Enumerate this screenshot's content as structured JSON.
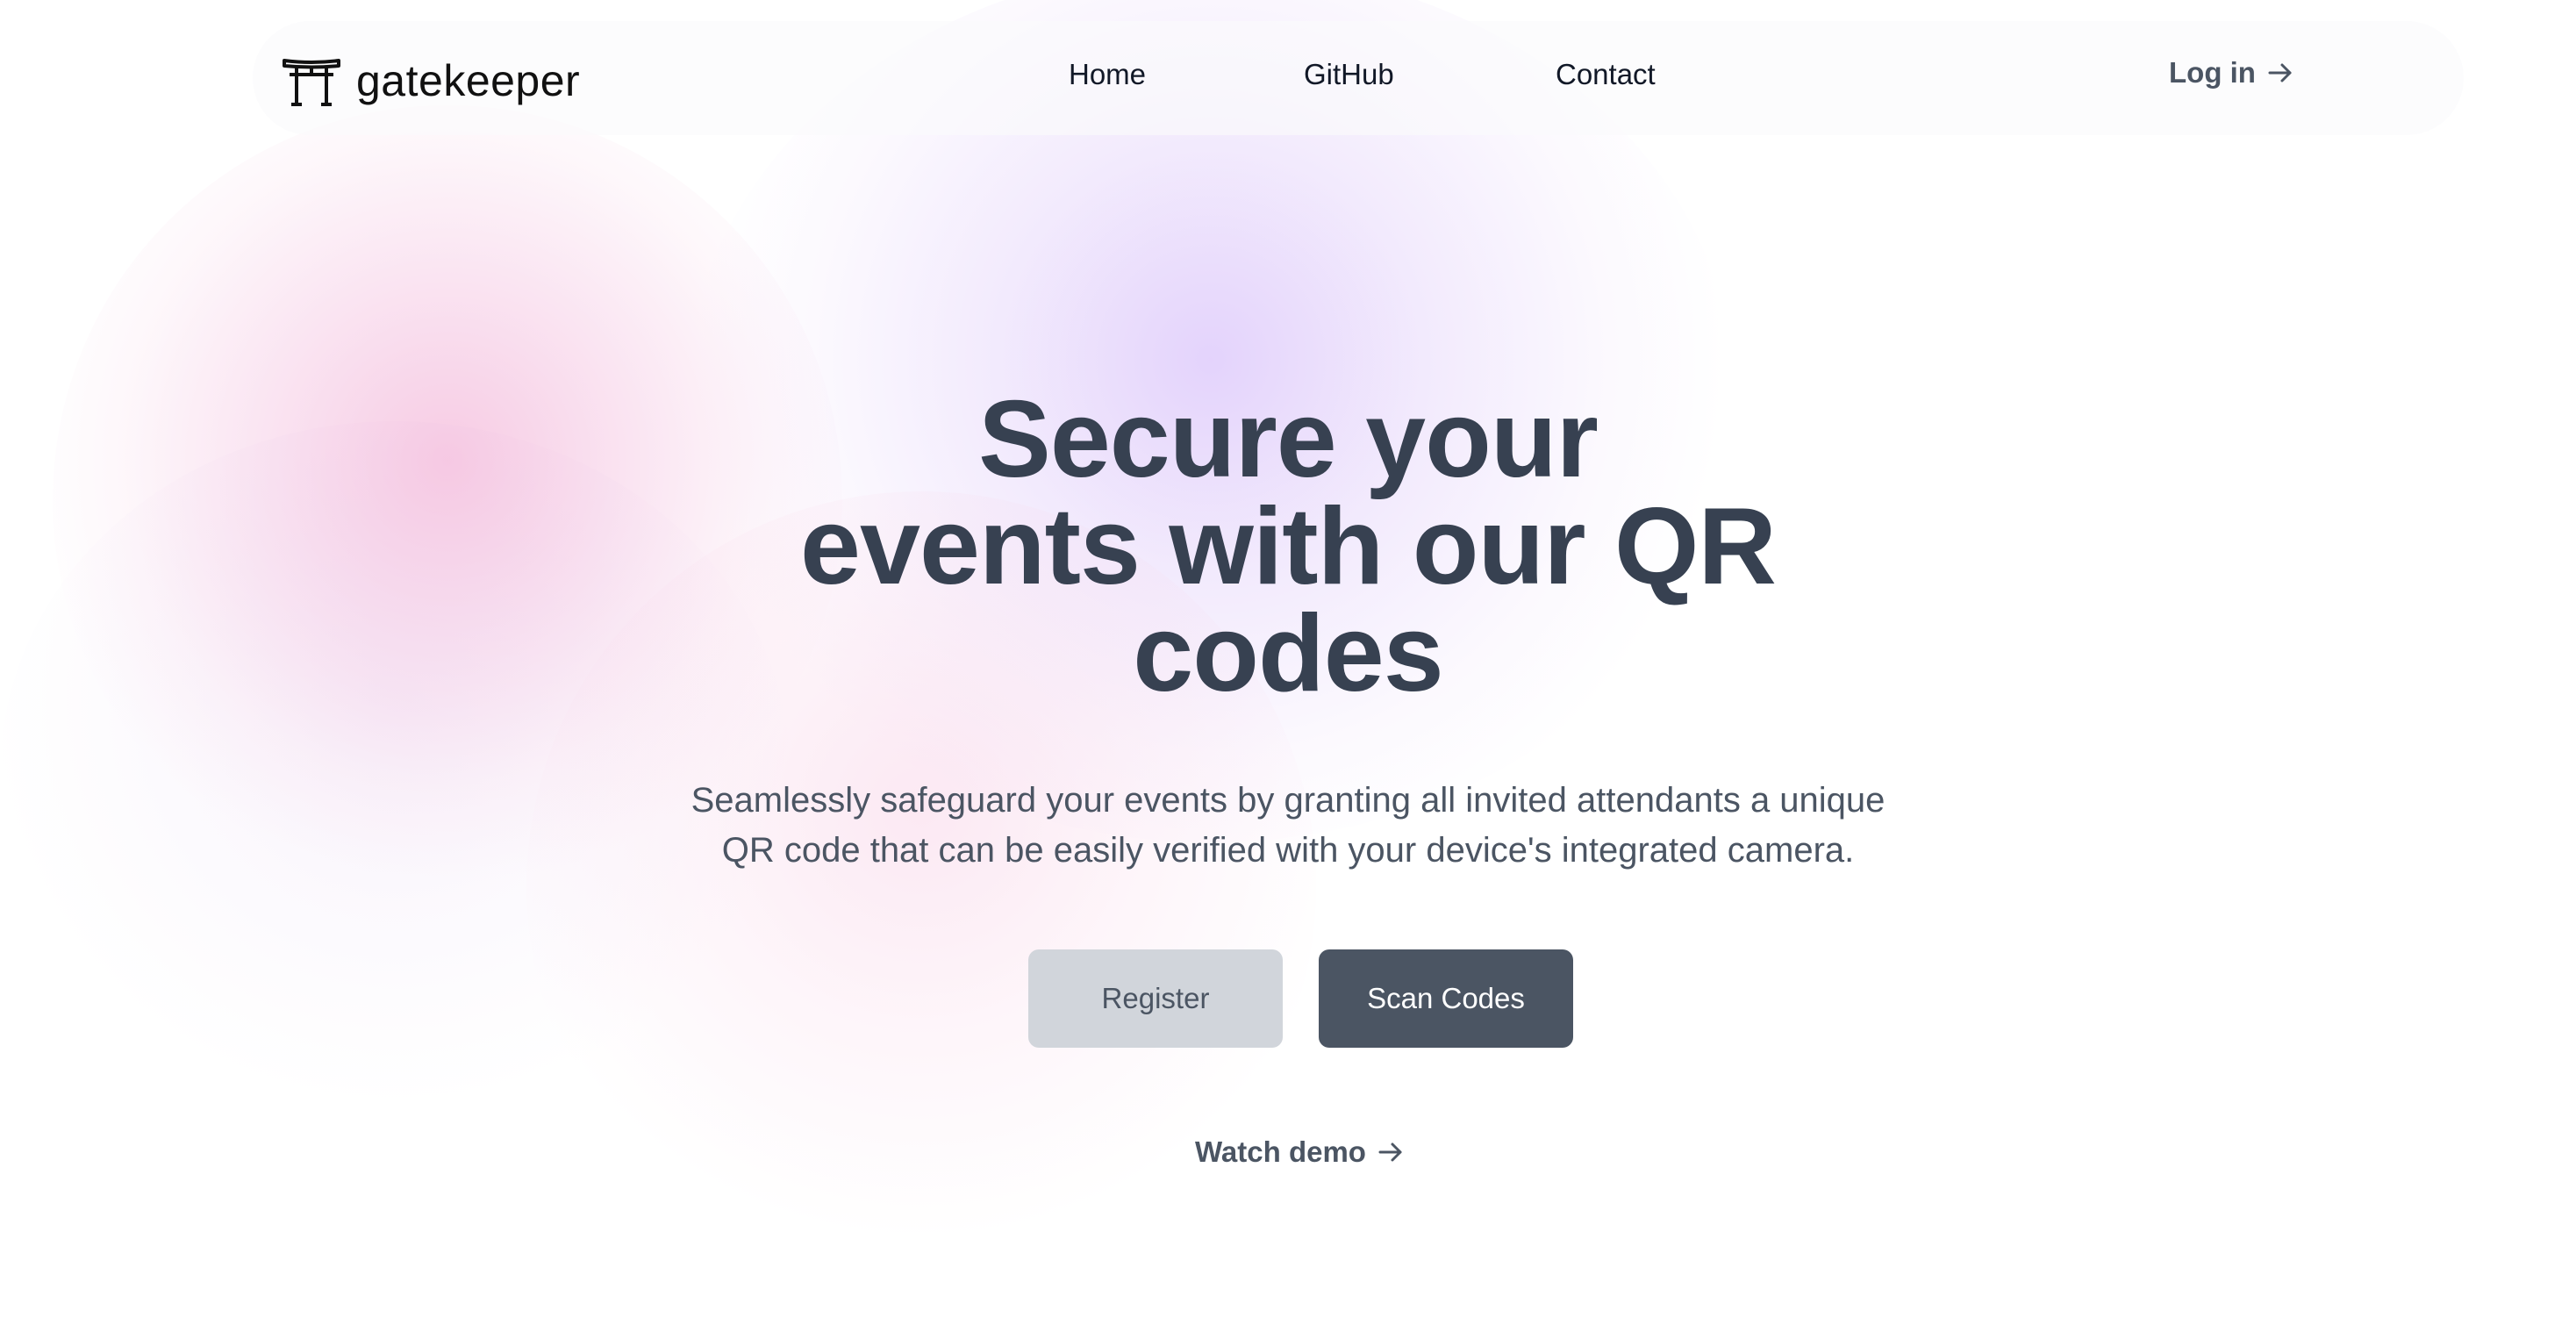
{
  "brand": {
    "name": "gatekeeper",
    "icon": "torii-gate-icon"
  },
  "nav": {
    "links": [
      {
        "label": "Home"
      },
      {
        "label": "GitHub"
      },
      {
        "label": "Contact"
      }
    ],
    "login_label": "Log in",
    "login_icon": "arrow-right-icon"
  },
  "hero": {
    "title_lines": [
      "Secure your",
      "events with our QR",
      "codes"
    ],
    "subtitle_lines": [
      "Seamlessly safeguard your events by granting all invited attendants a unique",
      "QR code that can be easily verified with your device's integrated camera."
    ],
    "register_label": "Register",
    "scan_label": "Scan Codes",
    "watch_demo_label": "Watch demo",
    "watch_demo_icon": "arrow-right-icon"
  },
  "colors": {
    "heading": "#374151",
    "body_text": "#4b5563",
    "primary_button": "#4b5563",
    "secondary_button": "#d1d5db",
    "blob_pink": "#f0a0cd",
    "blob_purple": "#cdaffa"
  }
}
